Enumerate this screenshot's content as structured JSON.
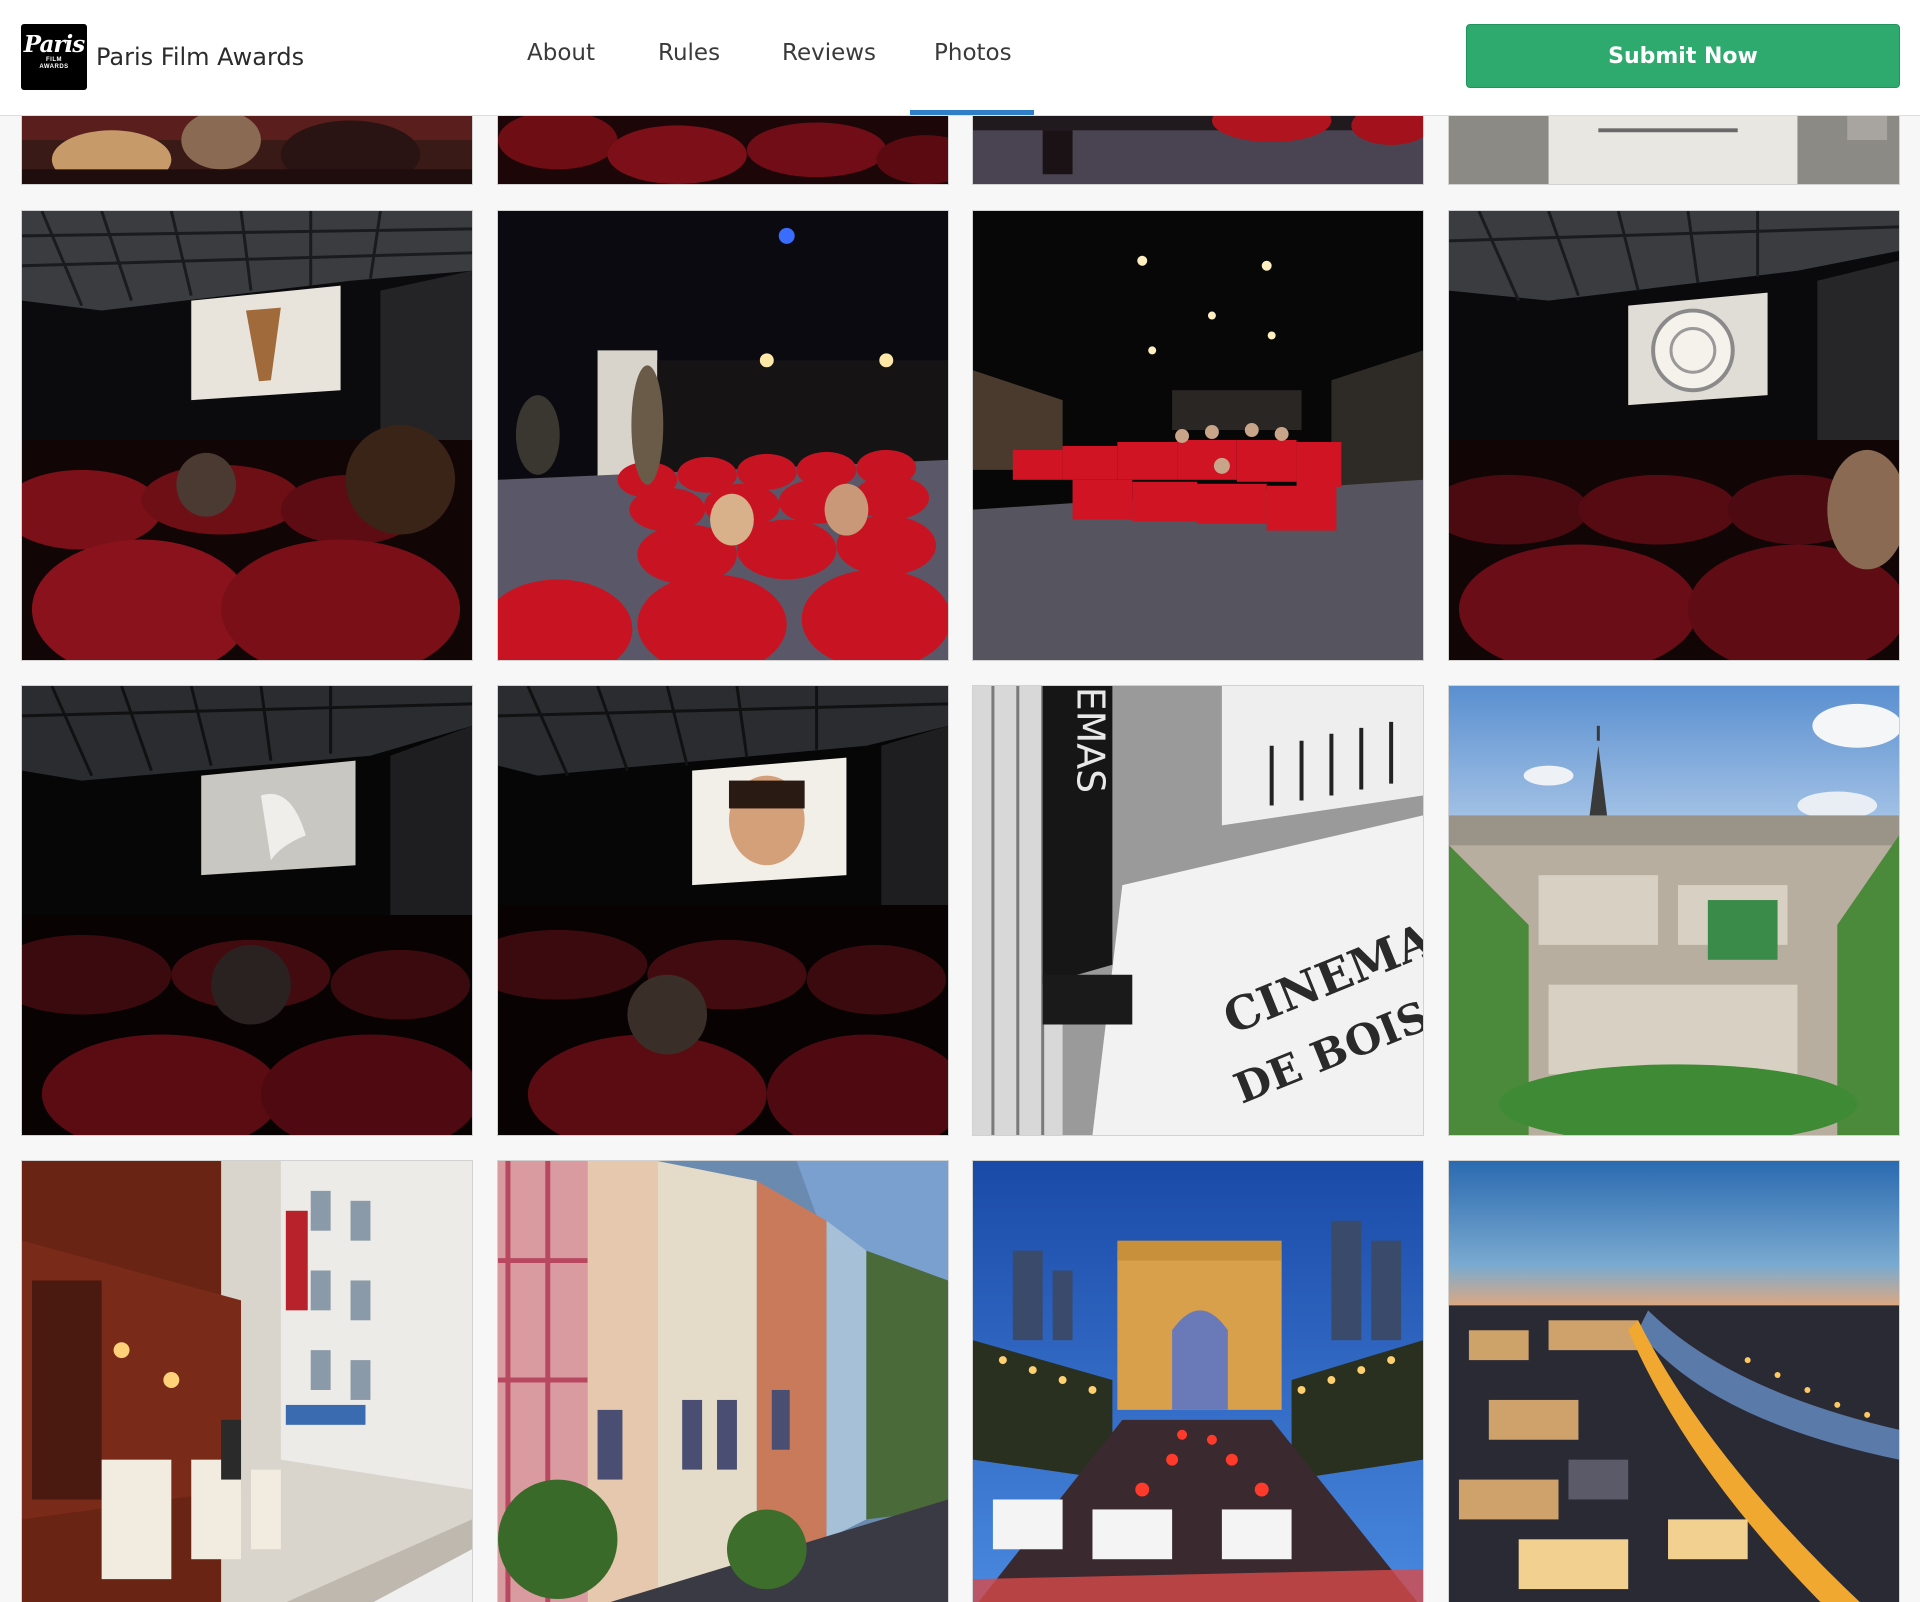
{
  "brand": {
    "logo_script": "Paris",
    "logo_small_1": "FILM",
    "logo_small_2": "AWARDS",
    "name": "Paris Film Awards"
  },
  "nav": {
    "about": "About",
    "rules": "Rules",
    "reviews": "Reviews",
    "photos": "Photos",
    "active": "Photos"
  },
  "cta": {
    "submit_label": "Submit Now",
    "color": "#2eaa6e"
  },
  "accent_color": "#2f7fc8",
  "photos": {
    "row0": [
      "cinema audience (partial)",
      "red seats (partial)",
      "theater floor (partial)",
      "document (partial)"
    ],
    "row1": [
      "dark theater screen",
      "audience red seats",
      "wide theater hall",
      "theater screen spiral"
    ],
    "row2": [
      "dark theater screen",
      "theater screen face",
      "cinema facade sign",
      "Eiffel tower view"
    ],
    "row3": [
      "paris street restaurant",
      "colorful paris street",
      "arc de triomphe night",
      "paris night aerial"
    ]
  },
  "photo_text": {
    "cinema_sign": "CINEMA",
    "cinema_sign_2": "DE BOIS",
    "neon": "NEMAS"
  }
}
